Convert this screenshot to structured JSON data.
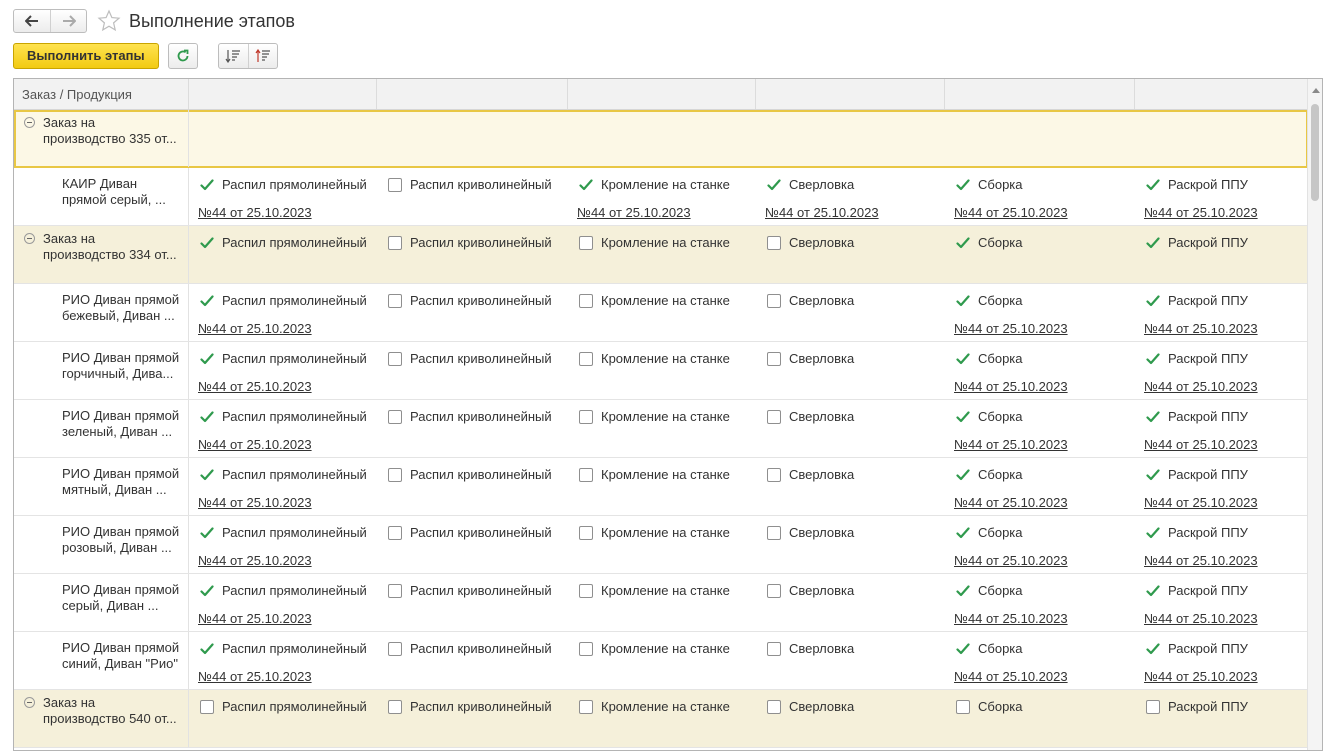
{
  "window": {
    "title": "Выполнение этапов",
    "back_icon": "arrow-left-icon",
    "forward_icon": "arrow-right-icon",
    "favorite_icon": "star-icon"
  },
  "toolbar": {
    "execute_label": "Выполнить этапы",
    "refresh_icon": "refresh-icon",
    "sort_asc_icon": "sort-ascending-icon",
    "sort_desc_icon": "sort-descending-icon"
  },
  "colors": {
    "accent": "#f2cb12",
    "check": "#2f9a4d",
    "group_row": "#f5f0da",
    "selected_border": "#e8c745"
  },
  "table": {
    "header": [
      "Заказ / Продукция",
      "",
      "",
      "",
      "",
      "",
      ""
    ],
    "rows": [
      {
        "type": "group",
        "selected": true,
        "name": "Заказ на\nпроизводство 335 от...",
        "stages": []
      },
      {
        "type": "item",
        "name": "КАИР Диван\nпрямой серый, ...",
        "stages": [
          {
            "label": "Распил прямолинейный",
            "checked": true,
            "doc": "№44 от 25.10.2023"
          },
          {
            "label": "Распил криволинейный",
            "checked": false,
            "doc": ""
          },
          {
            "label": "Кромление на станке",
            "checked": true,
            "doc": "№44 от 25.10.2023"
          },
          {
            "label": "Сверловка",
            "checked": true,
            "doc": "№44 от 25.10.2023"
          },
          {
            "label": "Сборка",
            "checked": true,
            "doc": "№44 от 25.10.2023"
          },
          {
            "label": "Раскрой ППУ",
            "checked": true,
            "doc": "№44 от 25.10.2023"
          }
        ]
      },
      {
        "type": "group",
        "name": "Заказ на\nпроизводство 334 от...",
        "stages": [
          {
            "label": "Распил прямолинейный",
            "checked": true,
            "doc": ""
          },
          {
            "label": "Распил криволинейный",
            "checked": false,
            "doc": ""
          },
          {
            "label": "Кромление на станке",
            "checked": false,
            "doc": ""
          },
          {
            "label": "Сверловка",
            "checked": false,
            "doc": ""
          },
          {
            "label": "Сборка",
            "checked": true,
            "doc": ""
          },
          {
            "label": "Раскрой ППУ",
            "checked": true,
            "doc": ""
          }
        ]
      },
      {
        "type": "item",
        "name": "РИО Диван прямой\nбежевый, Диван ...",
        "stages": [
          {
            "label": "Распил прямолинейный",
            "checked": true,
            "doc": "№44 от 25.10.2023"
          },
          {
            "label": "Распил криволинейный",
            "checked": false,
            "doc": ""
          },
          {
            "label": "Кромление на станке",
            "checked": false,
            "doc": ""
          },
          {
            "label": "Сверловка",
            "checked": false,
            "doc": ""
          },
          {
            "label": "Сборка",
            "checked": true,
            "doc": "№44 от 25.10.2023"
          },
          {
            "label": "Раскрой ППУ",
            "checked": true,
            "doc": "№44 от 25.10.2023"
          }
        ]
      },
      {
        "type": "item",
        "name": "РИО Диван прямой\nгорчичный, Дива...",
        "stages": [
          {
            "label": "Распил прямолинейный",
            "checked": true,
            "doc": "№44 от 25.10.2023"
          },
          {
            "label": "Распил криволинейный",
            "checked": false,
            "doc": ""
          },
          {
            "label": "Кромление на станке",
            "checked": false,
            "doc": ""
          },
          {
            "label": "Сверловка",
            "checked": false,
            "doc": ""
          },
          {
            "label": "Сборка",
            "checked": true,
            "doc": "№44 от 25.10.2023"
          },
          {
            "label": "Раскрой ППУ",
            "checked": true,
            "doc": "№44 от 25.10.2023"
          }
        ]
      },
      {
        "type": "item",
        "name": "РИО Диван прямой\nзеленый, Диван ...",
        "stages": [
          {
            "label": "Распил прямолинейный",
            "checked": true,
            "doc": "№44 от 25.10.2023"
          },
          {
            "label": "Распил криволинейный",
            "checked": false,
            "doc": ""
          },
          {
            "label": "Кромление на станке",
            "checked": false,
            "doc": ""
          },
          {
            "label": "Сверловка",
            "checked": false,
            "doc": ""
          },
          {
            "label": "Сборка",
            "checked": true,
            "doc": "№44 от 25.10.2023"
          },
          {
            "label": "Раскрой ППУ",
            "checked": true,
            "doc": "№44 от 25.10.2023"
          }
        ]
      },
      {
        "type": "item",
        "name": "РИО Диван прямой\nмятный, Диван ...",
        "stages": [
          {
            "label": "Распил прямолинейный",
            "checked": true,
            "doc": "№44 от 25.10.2023"
          },
          {
            "label": "Распил криволинейный",
            "checked": false,
            "doc": ""
          },
          {
            "label": "Кромление на станке",
            "checked": false,
            "doc": ""
          },
          {
            "label": "Сверловка",
            "checked": false,
            "doc": ""
          },
          {
            "label": "Сборка",
            "checked": true,
            "doc": "№44 от 25.10.2023"
          },
          {
            "label": "Раскрой ППУ",
            "checked": true,
            "doc": "№44 от 25.10.2023"
          }
        ]
      },
      {
        "type": "item",
        "name": "РИО Диван прямой\nрозовый, Диван ...",
        "stages": [
          {
            "label": "Распил прямолинейный",
            "checked": true,
            "doc": "№44 от 25.10.2023"
          },
          {
            "label": "Распил криволинейный",
            "checked": false,
            "doc": ""
          },
          {
            "label": "Кромление на станке",
            "checked": false,
            "doc": ""
          },
          {
            "label": "Сверловка",
            "checked": false,
            "doc": ""
          },
          {
            "label": "Сборка",
            "checked": true,
            "doc": "№44 от 25.10.2023"
          },
          {
            "label": "Раскрой ППУ",
            "checked": true,
            "doc": "№44 от 25.10.2023"
          }
        ]
      },
      {
        "type": "item",
        "name": "РИО Диван прямой\nсерый, Диван ...",
        "stages": [
          {
            "label": "Распил прямолинейный",
            "checked": true,
            "doc": "№44 от 25.10.2023"
          },
          {
            "label": "Распил криволинейный",
            "checked": false,
            "doc": ""
          },
          {
            "label": "Кромление на станке",
            "checked": false,
            "doc": ""
          },
          {
            "label": "Сверловка",
            "checked": false,
            "doc": ""
          },
          {
            "label": "Сборка",
            "checked": true,
            "doc": "№44 от 25.10.2023"
          },
          {
            "label": "Раскрой ППУ",
            "checked": true,
            "doc": "№44 от 25.10.2023"
          }
        ]
      },
      {
        "type": "item",
        "name": "РИО Диван прямой\nсиний, Диван \"Рио\"",
        "stages": [
          {
            "label": "Распил прямолинейный",
            "checked": true,
            "doc": "№44 от 25.10.2023"
          },
          {
            "label": "Распил криволинейный",
            "checked": false,
            "doc": ""
          },
          {
            "label": "Кромление на станке",
            "checked": false,
            "doc": ""
          },
          {
            "label": "Сверловка",
            "checked": false,
            "doc": ""
          },
          {
            "label": "Сборка",
            "checked": true,
            "doc": "№44 от 25.10.2023"
          },
          {
            "label": "Раскрой ППУ",
            "checked": true,
            "doc": "№44 от 25.10.2023"
          }
        ]
      },
      {
        "type": "group",
        "name": "Заказ на\nпроизводство 540 от...",
        "stages": [
          {
            "label": "Распил прямолинейный",
            "checked": false,
            "doc": ""
          },
          {
            "label": "Распил криволинейный",
            "checked": false,
            "doc": ""
          },
          {
            "label": "Кромление на станке",
            "checked": false,
            "doc": ""
          },
          {
            "label": "Сверловка",
            "checked": false,
            "doc": ""
          },
          {
            "label": "Сборка",
            "checked": false,
            "doc": ""
          },
          {
            "label": "Раскрой ППУ",
            "checked": false,
            "doc": ""
          }
        ]
      }
    ]
  }
}
